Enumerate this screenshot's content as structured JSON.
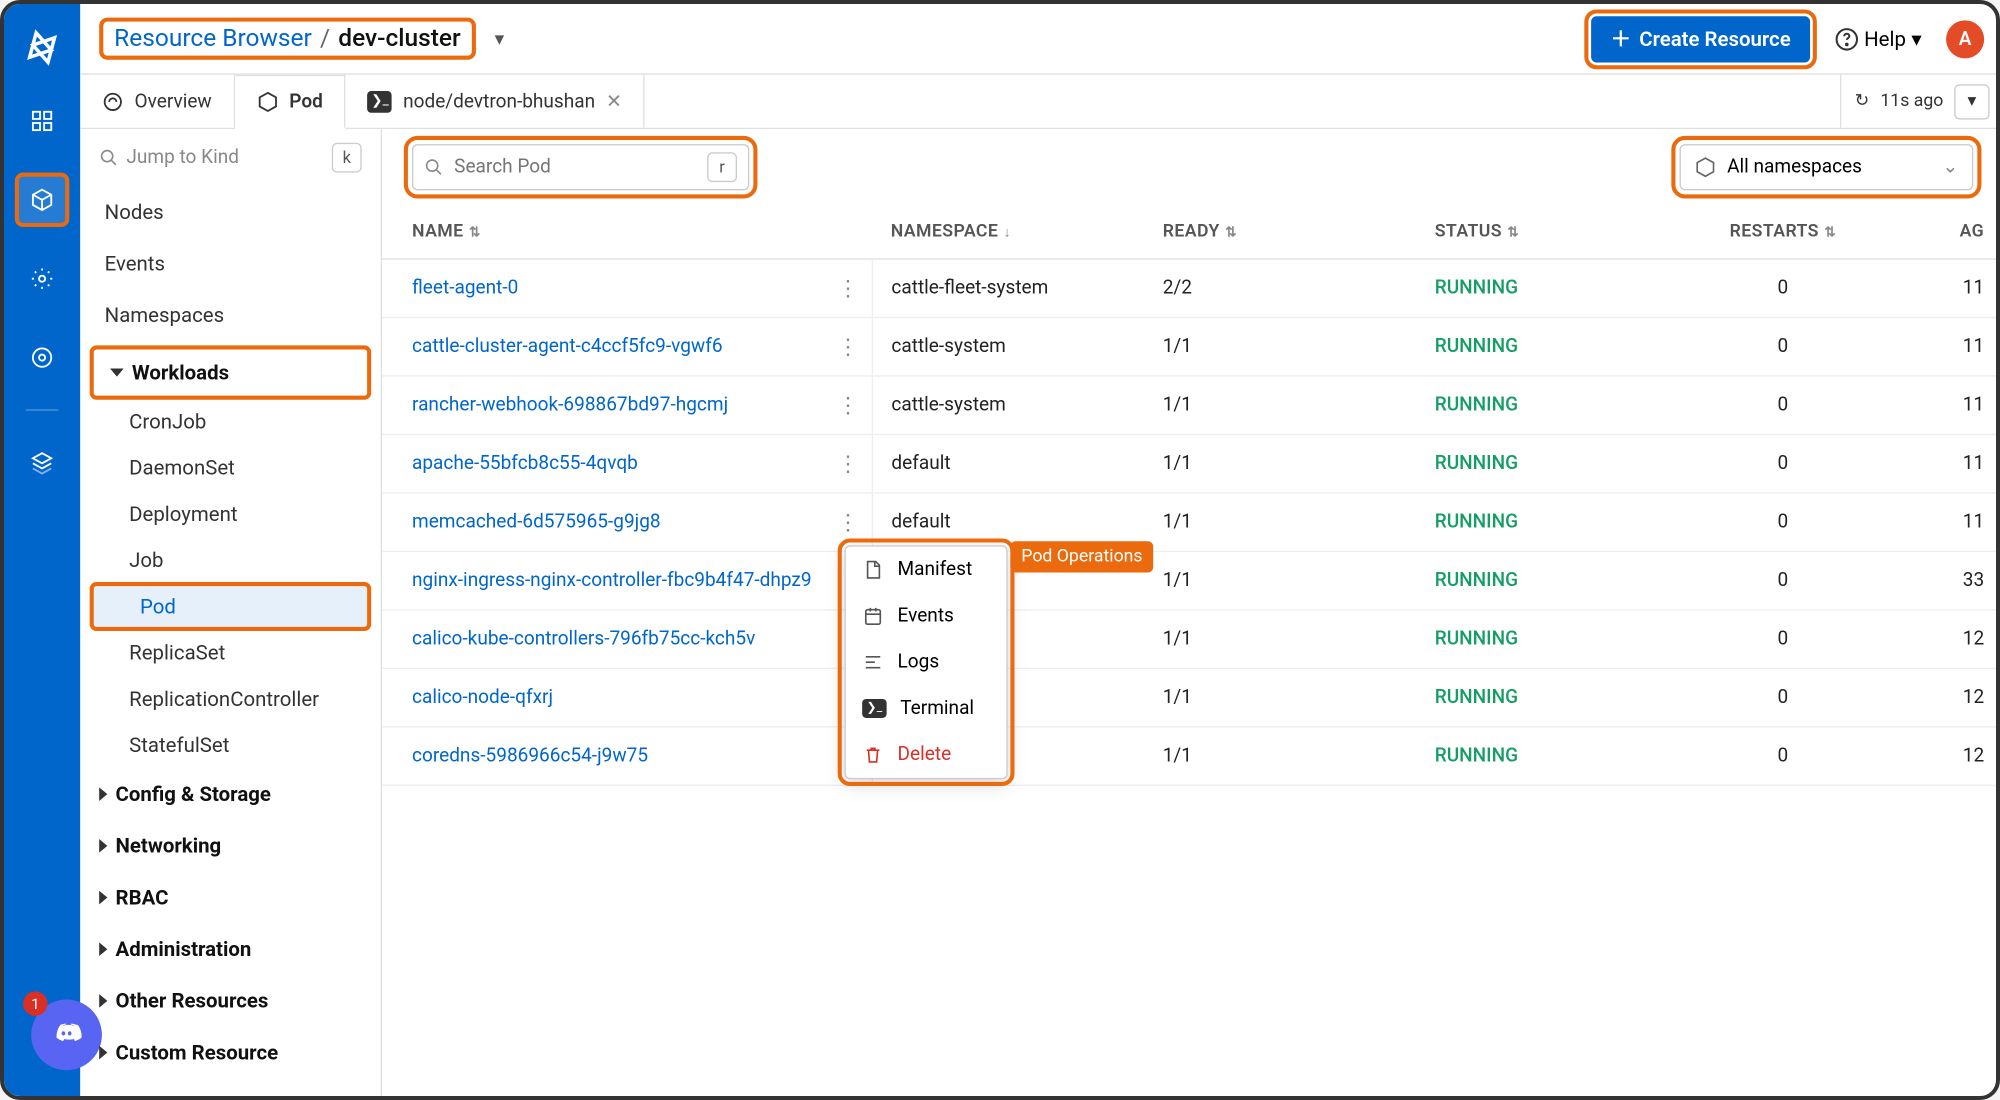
{
  "breadcrumb": {
    "root": "Resource Browser",
    "sep": "/",
    "current": "dev-cluster"
  },
  "topbar": {
    "create": "Create Resource",
    "help": "Help",
    "avatar": "A"
  },
  "tabs": {
    "overview": "Overview",
    "pod": "Pod",
    "node": "node/devtron-bhushan",
    "refresh": "11s ago"
  },
  "sidebar": {
    "jump_placeholder": "Jump to Kind",
    "jump_key": "k",
    "top_items": [
      "Nodes",
      "Events",
      "Namespaces"
    ],
    "groups": {
      "workloads": {
        "label": "Workloads",
        "items": [
          "CronJob",
          "DaemonSet",
          "Deployment",
          "Job",
          "Pod",
          "ReplicaSet",
          "ReplicationController",
          "StatefulSet"
        ]
      },
      "config": "Config & Storage",
      "networking": "Networking",
      "rbac": "RBAC",
      "administration": "Administration",
      "other": "Other Resources",
      "custom": "Custom Resource"
    }
  },
  "filters": {
    "search_placeholder": "Search Pod",
    "search_key": "r",
    "namespace": "All namespaces"
  },
  "table": {
    "cols": [
      "NAME",
      "NAMESPACE",
      "READY",
      "STATUS",
      "RESTARTS",
      "AG"
    ],
    "rows": [
      {
        "name": "fleet-agent-0",
        "ns": "cattle-fleet-system",
        "ready": "2/2",
        "status": "RUNNING",
        "restarts": "0",
        "age": "11"
      },
      {
        "name": "cattle-cluster-agent-c4ccf5fc9-vgwf6",
        "ns": "cattle-system",
        "ready": "1/1",
        "status": "RUNNING",
        "restarts": "0",
        "age": "11"
      },
      {
        "name": "rancher-webhook-698867bd97-hgcmj",
        "ns": "cattle-system",
        "ready": "1/1",
        "status": "RUNNING",
        "restarts": "0",
        "age": "11"
      },
      {
        "name": "apache-55bfcb8c55-4qvqb",
        "ns": "default",
        "ready": "1/1",
        "status": "RUNNING",
        "restarts": "0",
        "age": "11"
      },
      {
        "name": "memcached-6d575965-g9jg8",
        "ns": "default",
        "ready": "1/1",
        "status": "RUNNING",
        "restarts": "0",
        "age": "11"
      },
      {
        "name": "nginx-ingress-nginx-controller-fbc9b4f47-dhpz9",
        "ns": "",
        "ready": "1/1",
        "status": "RUNNING",
        "restarts": "0",
        "age": "33"
      },
      {
        "name": "calico-kube-controllers-796fb75cc-kch5v",
        "ns": "",
        "ready": "1/1",
        "status": "RUNNING",
        "restarts": "0",
        "age": "12"
      },
      {
        "name": "calico-node-qfxrj",
        "ns": "",
        "ready": "1/1",
        "status": "RUNNING",
        "restarts": "0",
        "age": "12"
      },
      {
        "name": "coredns-5986966c54-j9w75",
        "ns": "",
        "ready": "1/1",
        "status": "RUNNING",
        "restarts": "0",
        "age": "12"
      }
    ]
  },
  "popup": {
    "label": "Pod Operations",
    "items": [
      "Manifest",
      "Events",
      "Logs",
      "Terminal",
      "Delete"
    ]
  },
  "discord_count": "1"
}
